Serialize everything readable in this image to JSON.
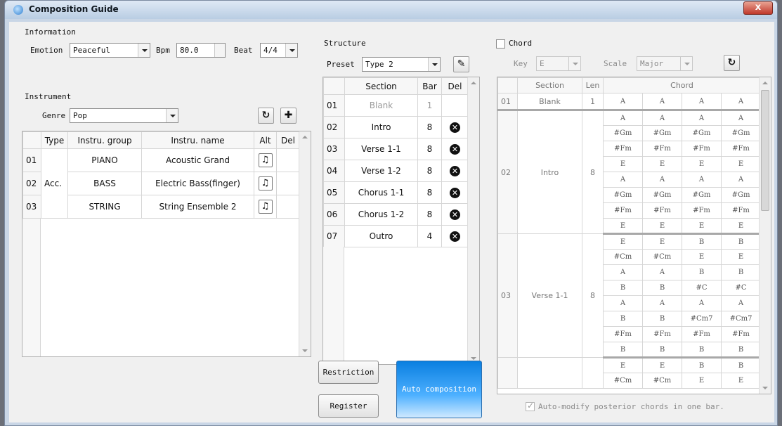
{
  "window": {
    "title": "Composition Guide",
    "close_label": "x"
  },
  "information": {
    "title": "Information",
    "emotion_label": "Emotion",
    "emotion_value": "Peaceful",
    "bpm_label": "Bpm",
    "bpm_value": "80.0",
    "beat_label": "Beat",
    "beat_value": "4/4"
  },
  "instrument": {
    "title": "Instrument",
    "genre_label": "Genre",
    "genre_value": "Pop",
    "columns": [
      "Type",
      "Instru. group",
      "Instru. name",
      "Alt",
      "Del"
    ],
    "type_value": "Acc.",
    "rows": [
      {
        "num": "01",
        "group": "PIANO",
        "name": "Acoustic Grand"
      },
      {
        "num": "02",
        "group": "BASS",
        "name": "Electric Bass(finger)"
      },
      {
        "num": "03",
        "group": "STRING",
        "name": "String Ensemble 2"
      }
    ]
  },
  "structure": {
    "title": "Structure",
    "preset_label": "Preset",
    "preset_value": "Type 2",
    "columns": [
      "Section",
      "Bar",
      "Del"
    ],
    "rows": [
      {
        "num": "01",
        "section": "Blank",
        "bar": "1"
      },
      {
        "num": "02",
        "section": "Intro",
        "bar": "8"
      },
      {
        "num": "03",
        "section": "Verse 1-1",
        "bar": "8"
      },
      {
        "num": "04",
        "section": "Verse 1-2",
        "bar": "8"
      },
      {
        "num": "05",
        "section": "Chorus 1-1",
        "bar": "8"
      },
      {
        "num": "06",
        "section": "Chorus 1-2",
        "bar": "8"
      },
      {
        "num": "07",
        "section": "Outro",
        "bar": "4"
      }
    ]
  },
  "buttons": {
    "restriction": "Restriction",
    "register": "Register",
    "auto_composition": "Auto composition"
  },
  "chord": {
    "title": "Chord",
    "key_label": "Key",
    "key_value": "E",
    "scale_label": "Scale",
    "scale_value": "Major",
    "columns": [
      "Section",
      "Len",
      "Chord"
    ],
    "blank": {
      "num": "01",
      "section": "Blank",
      "len": "1",
      "chords": [
        "A",
        "A",
        "A",
        "A"
      ]
    },
    "intro": {
      "num": "02",
      "section": "Intro",
      "len": "8",
      "rows": [
        [
          "A",
          "A",
          "A",
          "A"
        ],
        [
          "#Gm",
          "#Gm",
          "#Gm",
          "#Gm"
        ],
        [
          "#Fm",
          "#Fm",
          "#Fm",
          "#Fm"
        ],
        [
          "E",
          "E",
          "E",
          "E"
        ],
        [
          "A",
          "A",
          "A",
          "A"
        ],
        [
          "#Gm",
          "#Gm",
          "#Gm",
          "#Gm"
        ],
        [
          "#Fm",
          "#Fm",
          "#Fm",
          "#Fm"
        ],
        [
          "E",
          "E",
          "E",
          "E"
        ]
      ]
    },
    "verse": {
      "num": "03",
      "section": "Verse 1-1",
      "len": "8",
      "rows": [
        [
          "E",
          "E",
          "B",
          "B"
        ],
        [
          "#Cm",
          "#Cm",
          "E",
          "E"
        ],
        [
          "A",
          "A",
          "B",
          "B"
        ],
        [
          "B",
          "B",
          "#C",
          "#C"
        ],
        [
          "A",
          "A",
          "A",
          "A"
        ],
        [
          "B",
          "B",
          "#Cm7",
          "#Cm7"
        ],
        [
          "#Fm",
          "#Fm",
          "#Fm",
          "#Fm"
        ],
        [
          "B",
          "B",
          "B",
          "B"
        ]
      ]
    },
    "next": {
      "rows": [
        [
          "E",
          "E",
          "B",
          "B"
        ],
        [
          "#Cm",
          "#Cm",
          "E",
          "E"
        ]
      ]
    },
    "auto_modify_label": "Auto-modify posterior chords in one bar."
  }
}
